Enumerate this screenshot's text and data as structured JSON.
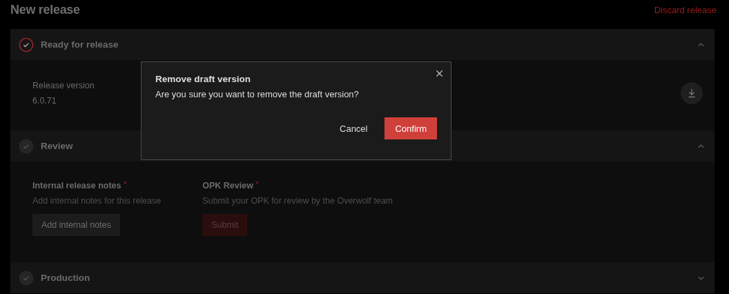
{
  "page": {
    "title": "New release",
    "discard_link": "Discard release"
  },
  "sections": [
    {
      "kind": "details",
      "title": "Ready for release",
      "highlighted": true,
      "expanded": true,
      "fields": [
        {
          "label": "Release version",
          "value": "6.0.71"
        }
      ]
    },
    {
      "kind": "review",
      "title": "Review",
      "highlighted": false,
      "expanded": true,
      "items": [
        {
          "label": "Internal release notes",
          "required": "*",
          "hint": "Add internal notes for this release",
          "button": "Add internal notes",
          "disabled": false,
          "primary": false
        },
        {
          "label": "OPK Review",
          "required": "*",
          "hint": "Submit your OPK for review by the Overwolf team",
          "button": "Submit",
          "disabled": true,
          "primary": true
        }
      ]
    },
    {
      "kind": "production",
      "title": "Production",
      "highlighted": false,
      "expanded": false
    }
  ],
  "dialog": {
    "title": "Remove draft version",
    "message": "Are you sure you want to remove the draft version?",
    "buttons": [
      {
        "label": "Cancel",
        "kind": "secondary"
      },
      {
        "label": "Confirm",
        "kind": "primary"
      }
    ]
  }
}
